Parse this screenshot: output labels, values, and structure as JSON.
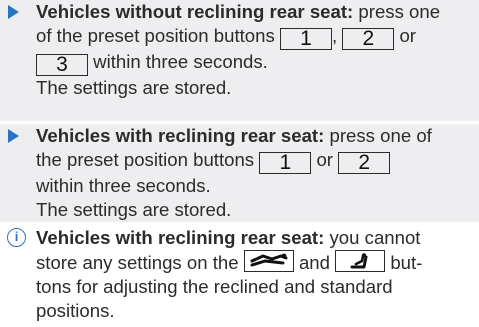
{
  "steps": [
    {
      "heading": "Vehicles without reclining rear seat:",
      "pre": "press one",
      "line2": "of the preset position buttons",
      "comma": ",",
      "or": "or",
      "line3_end": "within three seconds.",
      "line4": "The settings are stored.",
      "keys": [
        "1",
        "2",
        "3"
      ]
    },
    {
      "heading": "Vehicles with reclining rear seat:",
      "pre": "press one of",
      "line2": "the preset position buttons",
      "or": "or",
      "line3": "within three seconds.",
      "line4": "The settings are stored.",
      "keys": [
        "1",
        "2"
      ]
    }
  ],
  "note": {
    "icon": "info-icon",
    "icon_glyph": "i",
    "heading": "Vehicles with reclining rear seat:",
    "pre": "you cannot",
    "line2_a": "store any settings on the",
    "and": "and",
    "line2_b": "but-",
    "line3": "tons for adjusting the reclined and standard",
    "line4": "positions."
  },
  "colors": {
    "accent": "#2a73c4",
    "step_bg": "#eeeef0",
    "text": "#2b2b2b"
  }
}
